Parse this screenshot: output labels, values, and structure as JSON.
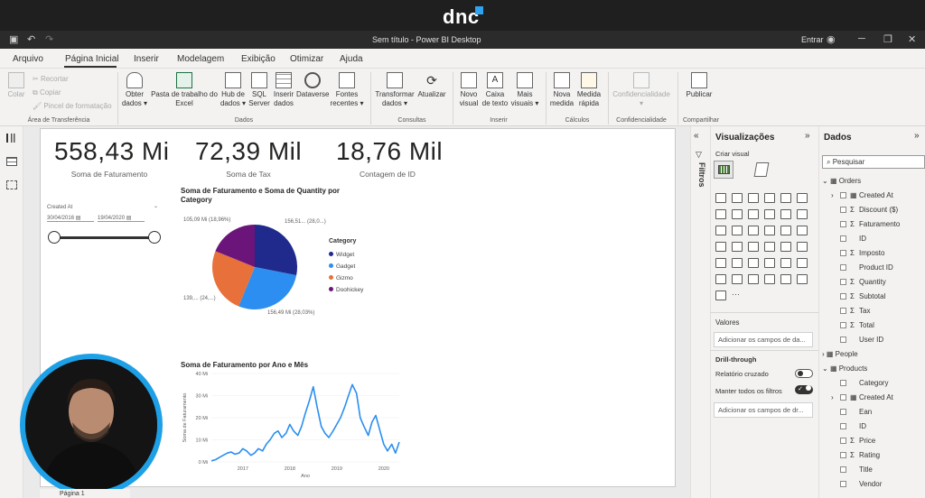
{
  "brand": {
    "name": "dnc"
  },
  "window": {
    "title": "Sem título - Power BI Desktop",
    "signin": "Entrar"
  },
  "menu": {
    "items": [
      "Arquivo",
      "Página Inicial",
      "Inserir",
      "Modelagem",
      "Exibição",
      "Otimizar",
      "Ajuda"
    ],
    "active": "Página Inicial"
  },
  "ribbon": {
    "clipboard": {
      "paste": "Colar",
      "cut": "Recortar",
      "copy": "Copiar",
      "format_painter": "Pincel de formatação",
      "group": "Área de Transferência"
    },
    "data": {
      "get_data": "Obter dados",
      "excel": "Pasta de trabalho do Excel",
      "hub": "Hub de dados",
      "sql": "SQL Server",
      "enter": "Inserir dados",
      "dataverse": "Dataverse",
      "recent": "Fontes recentes",
      "group": "Dados"
    },
    "queries": {
      "transform": "Transformar dados",
      "refresh": "Atualizar",
      "group": "Consultas"
    },
    "insert": {
      "new_visual": "Novo visual",
      "text_box": "Caixa de texto",
      "more_visuals": "Mais visuais",
      "group": "Inserir"
    },
    "calc": {
      "new_measure": "Nova medida",
      "quick_measure": "Medida rápida",
      "group": "Cálculos"
    },
    "sensitivity": {
      "label": "Confidencialidade",
      "group": "Confidencialidade"
    },
    "share": {
      "publish": "Publicar",
      "group": "Compartilhar"
    }
  },
  "kpis": [
    {
      "value": "558,43 Mi",
      "label": "Soma de Faturamento"
    },
    {
      "value": "72,39 Mil",
      "label": "Soma de Tax"
    },
    {
      "value": "18,76 Mil",
      "label": "Contagem de ID"
    }
  ],
  "slicer": {
    "title": "Created At",
    "from": "30/04/2016",
    "to": "19/04/2020"
  },
  "pie": {
    "title": "Soma de Faturamento e Soma de Quantity por Category",
    "legend_title": "Category",
    "labels": {
      "top_left": "105,09 Mi (18,96%)",
      "top_right": "156,51... (28,0...)",
      "bottom_left": "139,... (24,...)",
      "bottom_right": "156,49 Mi (28,03%)"
    }
  },
  "line": {
    "title": "Soma de Faturamento por Ano e Mês",
    "ylabel": "Soma de Faturamento",
    "xlabel": "Ano"
  },
  "chart_data": [
    {
      "type": "pie",
      "title": "Soma de Faturamento e Soma de Quantity por Category",
      "legend": "right",
      "slices": [
        {
          "name": "Widget",
          "value": 156.51,
          "color": "#1f2a8c"
        },
        {
          "name": "Gadget",
          "value": 156.49,
          "color": "#2b8ef0"
        },
        {
          "name": "Gizmo",
          "value": 139.0,
          "color": "#e8703a"
        },
        {
          "name": "Doohickey",
          "value": 105.09,
          "color": "#6b157a"
        }
      ]
    },
    {
      "type": "line",
      "title": "Soma de Faturamento por Ano e Mês",
      "xlabel": "Ano",
      "ylabel": "Soma de Faturamento",
      "x_ticks": [
        "2017",
        "2018",
        "2019",
        "2020"
      ],
      "y_ticks": [
        "0 Mi",
        "10 Mi",
        "20 Mi",
        "30 Mi",
        "40 Mi"
      ],
      "ylim": [
        0,
        40
      ],
      "xlim": [
        2016.33,
        2020.33
      ],
      "color": "#2b8ef0",
      "points": [
        [
          2016.33,
          0.5
        ],
        [
          2016.42,
          1
        ],
        [
          2016.5,
          2
        ],
        [
          2016.58,
          3
        ],
        [
          2016.67,
          4
        ],
        [
          2016.75,
          4.5
        ],
        [
          2016.83,
          3.5
        ],
        [
          2016.92,
          4
        ],
        [
          2017.0,
          6
        ],
        [
          2017.08,
          5
        ],
        [
          2017.17,
          3
        ],
        [
          2017.25,
          4
        ],
        [
          2017.33,
          6
        ],
        [
          2017.42,
          5
        ],
        [
          2017.5,
          8
        ],
        [
          2017.58,
          10
        ],
        [
          2017.67,
          13
        ],
        [
          2017.75,
          14
        ],
        [
          2017.83,
          11
        ],
        [
          2017.92,
          13
        ],
        [
          2018.0,
          17
        ],
        [
          2018.08,
          14
        ],
        [
          2018.17,
          12
        ],
        [
          2018.25,
          16
        ],
        [
          2018.33,
          22
        ],
        [
          2018.42,
          28
        ],
        [
          2018.5,
          34
        ],
        [
          2018.58,
          25
        ],
        [
          2018.67,
          16
        ],
        [
          2018.75,
          13
        ],
        [
          2018.83,
          11
        ],
        [
          2018.92,
          14
        ],
        [
          2019.0,
          17
        ],
        [
          2019.08,
          20
        ],
        [
          2019.17,
          25
        ],
        [
          2019.25,
          30
        ],
        [
          2019.33,
          35
        ],
        [
          2019.42,
          31
        ],
        [
          2019.5,
          20
        ],
        [
          2019.58,
          16
        ],
        [
          2019.67,
          12
        ],
        [
          2019.75,
          18
        ],
        [
          2019.83,
          21
        ],
        [
          2019.92,
          14
        ],
        [
          2020.0,
          8
        ],
        [
          2020.08,
          5
        ],
        [
          2020.17,
          8
        ],
        [
          2020.25,
          4
        ],
        [
          2020.33,
          9
        ]
      ]
    }
  ],
  "viz_pane": {
    "title": "Visualizações",
    "create": "Criar visual",
    "values": "Valores",
    "values_well": "Adicionar os campos de da...",
    "drill": "Drill-through",
    "cross_report": "Relatório cruzado",
    "keep_filters": "Manter todos os filtros",
    "drill_well": "Adicionar os campos de dr..."
  },
  "filters_pane": {
    "title": "Filtros"
  },
  "data_pane": {
    "title": "Dados",
    "search": "Pesquisar",
    "tables": [
      {
        "name": "Orders",
        "fields": [
          {
            "name": "Created At",
            "kind": "table"
          },
          {
            "name": "Discount ($)",
            "kind": "sum"
          },
          {
            "name": "Faturamento",
            "kind": "sum"
          },
          {
            "name": "ID",
            "kind": "plain"
          },
          {
            "name": "Imposto",
            "kind": "sum"
          },
          {
            "name": "Product ID",
            "kind": "plain"
          },
          {
            "name": "Quantity",
            "kind": "sum"
          },
          {
            "name": "Subtotal",
            "kind": "sum"
          },
          {
            "name": "Tax",
            "kind": "sum"
          },
          {
            "name": "Total",
            "kind": "sum"
          },
          {
            "name": "User ID",
            "kind": "plain"
          }
        ]
      },
      {
        "name": "People",
        "fields": []
      },
      {
        "name": "Products",
        "fields": [
          {
            "name": "Category",
            "kind": "plain"
          },
          {
            "name": "Created At",
            "kind": "table"
          },
          {
            "name": "Ean",
            "kind": "plain"
          },
          {
            "name": "ID",
            "kind": "plain"
          },
          {
            "name": "Price",
            "kind": "sum"
          },
          {
            "name": "Rating",
            "kind": "sum"
          },
          {
            "name": "Title",
            "kind": "plain"
          },
          {
            "name": "Vendor",
            "kind": "plain"
          }
        ]
      }
    ]
  },
  "page_tab": "Página 1"
}
